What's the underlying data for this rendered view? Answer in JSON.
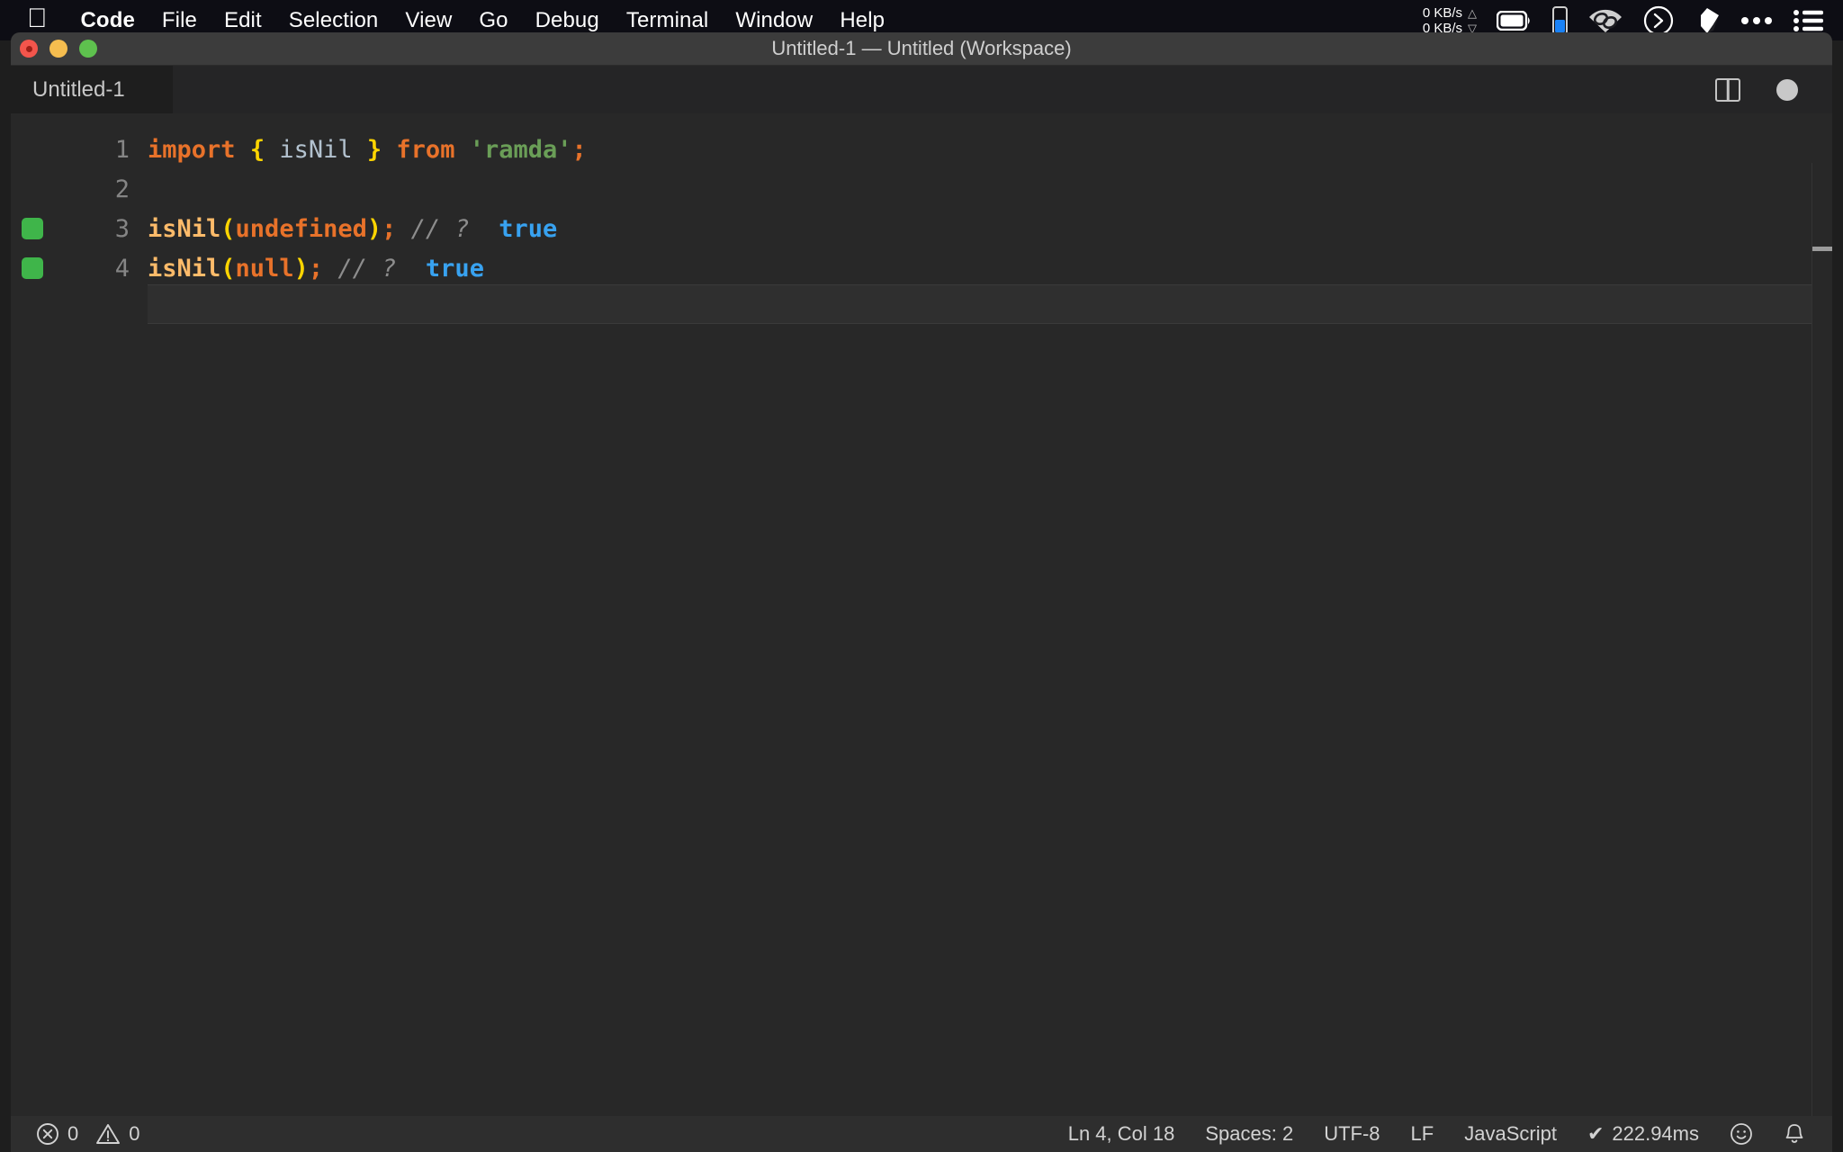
{
  "menubar": {
    "apple_icon": "apple-logo-icon",
    "items": [
      {
        "label": "Code",
        "bold": true
      },
      {
        "label": "File",
        "bold": false
      },
      {
        "label": "Edit",
        "bold": false
      },
      {
        "label": "Selection",
        "bold": false
      },
      {
        "label": "View",
        "bold": false
      },
      {
        "label": "Go",
        "bold": false
      },
      {
        "label": "Debug",
        "bold": false
      },
      {
        "label": "Terminal",
        "bold": false
      },
      {
        "label": "Window",
        "bold": false
      },
      {
        "label": "Help",
        "bold": false
      }
    ],
    "network": {
      "upload": "0 KB/s",
      "download": "0 KB/s",
      "up_arrow": "△",
      "down_arrow": "▽"
    },
    "icons": [
      "battery-icon",
      "iphone-battery-icon",
      "airdrop-link-icon",
      "shell-prompt-icon",
      "dropbox-icon",
      "ellipsis-icon",
      "control-center-list-icon"
    ]
  },
  "window": {
    "title": "Untitled-1 — Untitled (Workspace)",
    "traffic_lights": [
      "close",
      "minimize",
      "zoom"
    ]
  },
  "tabbar": {
    "tab_label": "Untitled-1",
    "actions": [
      "split-editor-icon",
      "unsaved-dot-icon"
    ]
  },
  "editor": {
    "language_colors": {
      "keyword": "#e8722a",
      "brace": "#ffd500",
      "identifier": "#b3c2cf",
      "string": "#6a9e57",
      "function": "#fdbb6a",
      "comment": "#8d8d8d",
      "boolean": "#38a2f0",
      "gutter_marker": "#3fb54a",
      "background": "#282828"
    },
    "current_line": 4,
    "lines": [
      {
        "number": "1",
        "marker": false,
        "tokens": [
          {
            "text": "import",
            "type": "keyword"
          },
          {
            "text": " ",
            "type": "plain"
          },
          {
            "text": "{",
            "type": "brace"
          },
          {
            "text": " ",
            "type": "plain"
          },
          {
            "text": "isNil",
            "type": "ident"
          },
          {
            "text": " ",
            "type": "plain"
          },
          {
            "text": "}",
            "type": "brace"
          },
          {
            "text": " ",
            "type": "plain"
          },
          {
            "text": "from",
            "type": "keyword"
          },
          {
            "text": " ",
            "type": "plain"
          },
          {
            "text": "'ramda'",
            "type": "string"
          },
          {
            "text": ";",
            "type": "punct"
          }
        ]
      },
      {
        "number": "2",
        "marker": false,
        "tokens": []
      },
      {
        "number": "3",
        "marker": true,
        "tokens": [
          {
            "text": "isNil",
            "type": "func"
          },
          {
            "text": "(",
            "type": "brace"
          },
          {
            "text": "undefined",
            "type": "const"
          },
          {
            "text": ")",
            "type": "brace"
          },
          {
            "text": ";",
            "type": "punct"
          },
          {
            "text": " ",
            "type": "plain"
          },
          {
            "text": "// ?",
            "type": "comment"
          },
          {
            "text": "  ",
            "type": "plain"
          },
          {
            "text": "true",
            "type": "bool"
          }
        ]
      },
      {
        "number": "4",
        "marker": true,
        "tokens": [
          {
            "text": "isNil",
            "type": "func"
          },
          {
            "text": "(",
            "type": "brace"
          },
          {
            "text": "null",
            "type": "const"
          },
          {
            "text": ")",
            "type": "brace"
          },
          {
            "text": ";",
            "type": "punct"
          },
          {
            "text": " ",
            "type": "plain"
          },
          {
            "text": "// ?",
            "type": "comment"
          },
          {
            "text": "  ",
            "type": "plain"
          },
          {
            "text": "true",
            "type": "bool"
          }
        ]
      }
    ]
  },
  "statusbar": {
    "errors": "0",
    "warnings": "0",
    "cursor_position": "Ln 4, Col 18",
    "indentation": "Spaces: 2",
    "encoding": "UTF-8",
    "eol": "LF",
    "language": "JavaScript",
    "runtime": "222.94ms",
    "runtime_check": "✔",
    "feedback_icon": "smiley-icon",
    "notifications_icon": "bell-icon"
  }
}
